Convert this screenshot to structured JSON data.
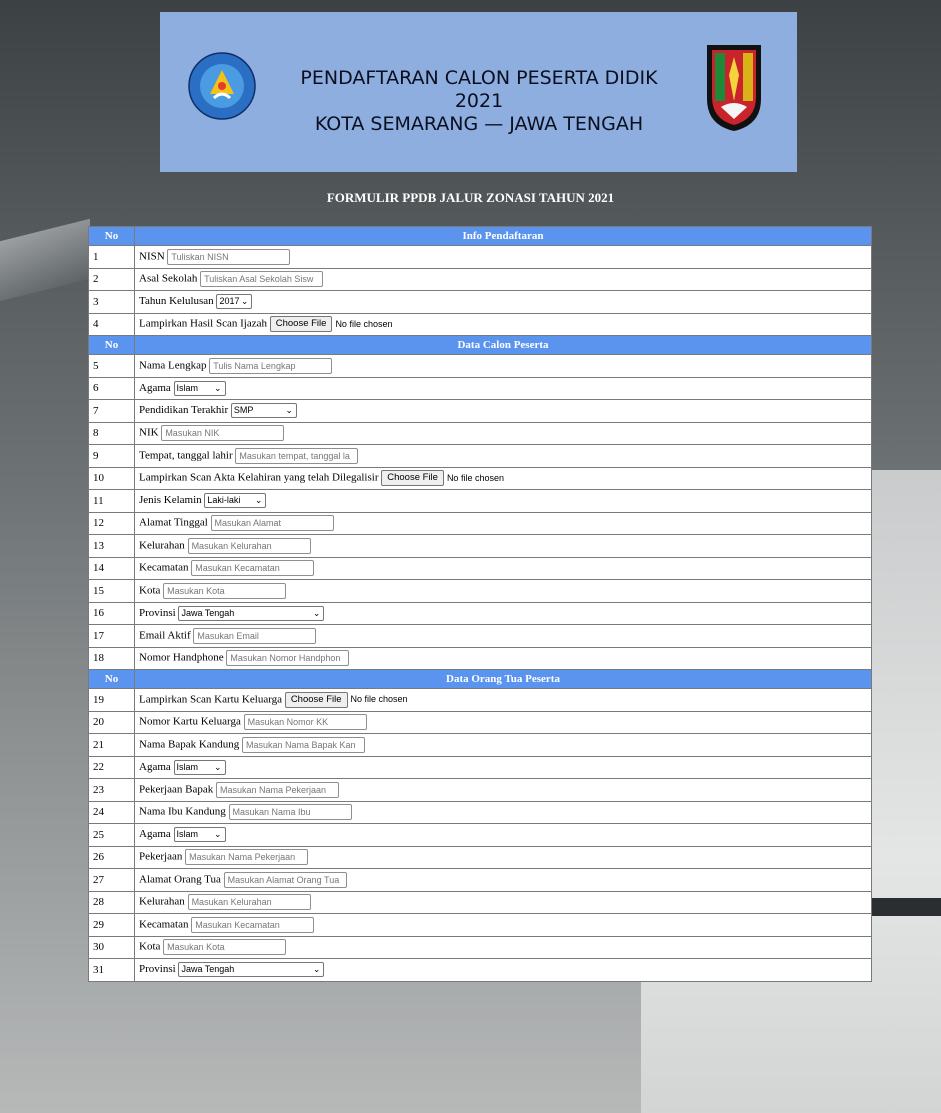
{
  "header": {
    "title_line1": "PENDAFTARAN CALON PESERTA DIDIK 2021",
    "title_line2": "KOTA SEMARANG — JAWA TENGAH",
    "logo_left_icon": "tut-wuri-handayani-emblem-icon",
    "logo_left_text": "TUT WURI HANDAYANI",
    "logo_right_icon": "jawa-tengah-emblem-icon"
  },
  "form_title": "FORMULIR PPDB JALUR ZONASI TAHUN 2021",
  "sections": {
    "info": {
      "no_header": "No",
      "title": "Info Pendaftaran"
    },
    "calon": {
      "no_header": "No",
      "title": "Data Calon Peserta"
    },
    "ortu": {
      "no_header": "No",
      "title": "Data Orang Tua Peserta"
    }
  },
  "file": {
    "button": "Choose File",
    "status": "No file chosen"
  },
  "rows": {
    "r1": {
      "no": "1",
      "label": "NISN",
      "placeholder": "Tuliskan NISN"
    },
    "r2": {
      "no": "2",
      "label": "Asal Sekolah",
      "placeholder": "Tuliskan Asal Sekolah Sisw"
    },
    "r3": {
      "no": "3",
      "label": "Tahun Kelulusan",
      "value": "2017"
    },
    "r4": {
      "no": "4",
      "label": "Lampirkan Hasil Scan Ijazah"
    },
    "r5": {
      "no": "5",
      "label": "Nama Lengkap",
      "placeholder": "Tulis Nama Lengkap"
    },
    "r6": {
      "no": "6",
      "label": "Agama",
      "value": "Islam"
    },
    "r7": {
      "no": "7",
      "label": "Pendidikan Terakhir",
      "value": "SMP"
    },
    "r8": {
      "no": "8",
      "label": "NIK",
      "placeholder": "Masukan NIK"
    },
    "r9": {
      "no": "9",
      "label": "Tempat, tanggal lahir",
      "placeholder": "Masukan tempat, tanggal la"
    },
    "r10": {
      "no": "10",
      "label": "Lampirkan Scan Akta Kelahiran yang telah Dilegalisir"
    },
    "r11": {
      "no": "11",
      "label": "Jenis Kelamin",
      "value": "Laki-laki"
    },
    "r12": {
      "no": "12",
      "label": "Alamat Tinggal",
      "placeholder": "Masukan Alamat"
    },
    "r13": {
      "no": "13",
      "label": "Kelurahan",
      "placeholder": "Masukan Kelurahan"
    },
    "r14": {
      "no": "14",
      "label": "Kecamatan",
      "placeholder": "Masukan Kecamatan"
    },
    "r15": {
      "no": "15",
      "label": "Kota",
      "placeholder": "Masukan Kota"
    },
    "r16": {
      "no": "16",
      "label": "Provinsi",
      "value": "Jawa Tengah"
    },
    "r17": {
      "no": "17",
      "label": "Email Aktif",
      "placeholder": "Masukan Email"
    },
    "r18": {
      "no": "18",
      "label": "Nomor Handphone",
      "placeholder": "Masukan Nomor Handphon"
    },
    "r19": {
      "no": "19",
      "label": "Lampirkan Scan Kartu Keluarga"
    },
    "r20": {
      "no": "20",
      "label": "Nomor Kartu Keluarga",
      "placeholder": "Masukan Nomor KK"
    },
    "r21": {
      "no": "21",
      "label": "Nama Bapak Kandung",
      "placeholder": "Masukan Nama Bapak Kan"
    },
    "r22": {
      "no": "22",
      "label": "Agama",
      "value": "Islam"
    },
    "r23": {
      "no": "23",
      "label": "Pekerjaan Bapak",
      "placeholder": "Masukan Nama Pekerjaan"
    },
    "r24": {
      "no": "24",
      "label": "Nama Ibu Kandung",
      "placeholder": "Masukan Nama Ibu"
    },
    "r25": {
      "no": "25",
      "label": "Agama",
      "value": "Islam"
    },
    "r26": {
      "no": "26",
      "label": "Pekerjaan",
      "placeholder": "Masukan Nama Pekerjaan"
    },
    "r27": {
      "no": "27",
      "label": "Alamat Orang Tua",
      "placeholder": "Masukan Alamat Orang Tua"
    },
    "r28": {
      "no": "28",
      "label": "Kelurahan",
      "placeholder": "Masukan Kelurahan"
    },
    "r29": {
      "no": "29",
      "label": "Kecamatan",
      "placeholder": "Masukan Kecamatan"
    },
    "r30": {
      "no": "30",
      "label": "Kota",
      "placeholder": "Masukan Kota"
    },
    "r31": {
      "no": "31",
      "label": "Provinsi",
      "value": "Jawa Tengah"
    }
  },
  "colors": {
    "header_bg": "#8eaee0",
    "section_header": "#5a94ee"
  }
}
